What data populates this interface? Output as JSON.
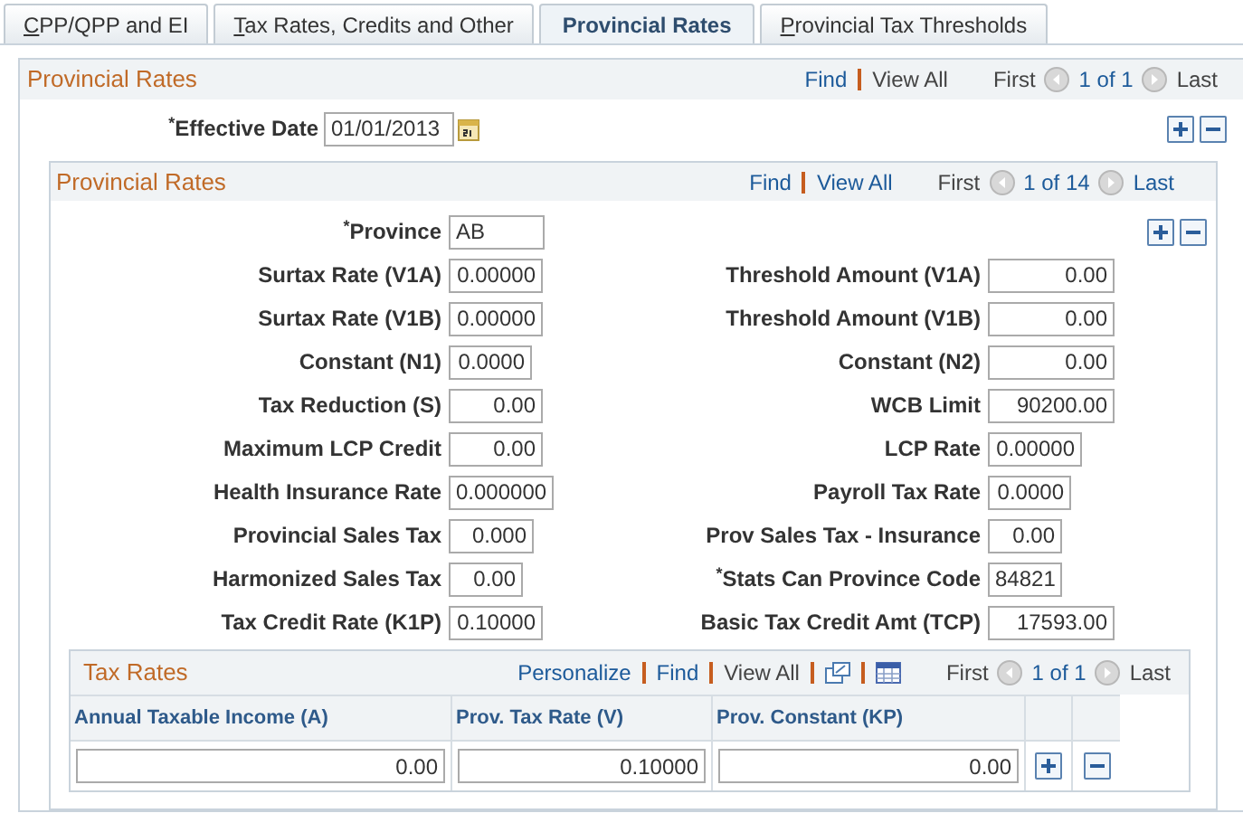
{
  "tabs": [
    {
      "label": "CPP/QPP and EI",
      "selected": false,
      "accesskey": true
    },
    {
      "label": "Tax Rates, Credits and Other",
      "selected": false,
      "accesskey": true
    },
    {
      "label": "Provincial Rates",
      "selected": true,
      "accesskey": false
    },
    {
      "label": "Provincial Tax Thresholds",
      "selected": false,
      "accesskey": true
    }
  ],
  "outer": {
    "title": "Provincial Rates",
    "nav": [
      {
        "text": "Find",
        "kind": "link"
      },
      {
        "text": "View All",
        "kind": "plain"
      }
    ],
    "first": "First",
    "count": "1 of 1",
    "last": "Last",
    "last_link": false,
    "effective_date": {
      "label": "$^{*}$Effective Date",
      "value": "01/01/2013"
    }
  },
  "inner": {
    "title": "Provincial Rates",
    "nav": [
      {
        "text": "Find",
        "kind": "link"
      },
      {
        "text": "View All",
        "kind": "link"
      }
    ],
    "first": "First",
    "count": "1 of 14",
    "last": "Last",
    "last_link": true,
    "province": {
      "label": "$^{*}$Province",
      "value": "AB"
    },
    "left_fields": [
      {
        "label": "Surtax Rate (V1A)",
        "value": "0.00000"
      },
      {
        "label": "Surtax Rate (V1B)",
        "value": "0.00000"
      },
      {
        "label": "Constant (N1)",
        "value": "0.0000"
      },
      {
        "label": "Tax Reduction (S)",
        "value": "0.00"
      },
      {
        "label": "Maximum LCP Credit",
        "value": "0.00"
      },
      {
        "label": "Health Insurance Rate",
        "value": "0.000000"
      },
      {
        "label": "Provincial Sales Tax",
        "value": "0.000"
      },
      {
        "label": "Harmonized Sales Tax",
        "value": "0.00"
      },
      {
        "label": "Tax Credit Rate (K1P)",
        "value": "0.10000"
      }
    ],
    "right_fields": [
      {
        "label": "Threshold Amount (V1A)",
        "value": "0.00"
      },
      {
        "label": "Threshold Amount (V1B)",
        "value": "0.00"
      },
      {
        "label": "Constant (N2)",
        "value": "0.00"
      },
      {
        "label": "WCB Limit",
        "value": "90200.00"
      },
      {
        "label": "LCP Rate",
        "value": "0.00000"
      },
      {
        "label": "Payroll Tax Rate",
        "value": "0.0000"
      },
      {
        "label": "Prov Sales Tax - Insurance",
        "value": "0.00"
      },
      {
        "label": "$^{*}$Stats Can Province Code",
        "value": "84821"
      },
      {
        "label": "Basic Tax Credit Amt (TCP)",
        "value": "17593.00"
      }
    ]
  },
  "tax_rates": {
    "title": "Tax Rates",
    "nav": [
      {
        "text": "Personalize",
        "kind": "link"
      },
      {
        "text": "Find",
        "kind": "link"
      },
      {
        "text": "View All",
        "kind": "plain"
      }
    ],
    "first": "First",
    "count": "1 of 1",
    "last": "Last",
    "columns": [
      "Annual Taxable Income (A)",
      "Prov. Tax Rate (V)",
      "Prov. Constant (KP)"
    ],
    "rows": [
      [
        "0.00",
        "0.10000",
        "0.00"
      ]
    ]
  }
}
